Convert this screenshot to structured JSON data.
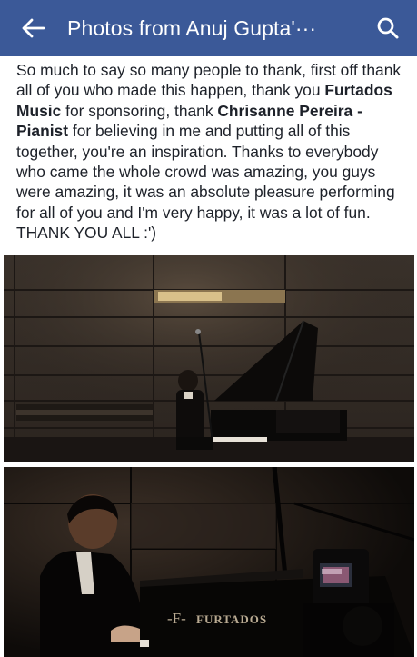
{
  "appbar": {
    "title": "Photos from Anuj Gupta'···",
    "back_icon": "arrow-left-icon",
    "search_icon": "search-icon",
    "color": "#3b5998"
  },
  "caption": {
    "p1": "So much to say so many people to thank, first off thank all of you who made this happen, thank you ",
    "bold1": "Furtados Music",
    "p2": " for sponsoring, thank ",
    "bold2": "Chrisanne Pereira - Pianist",
    "p3": " for believing in me and putting all of this together, you're an inspiration. Thanks to everybody who came the whole crowd was amazing, you guys were amazing, it was an absolute pleasure performing for all of you and I'm very happy, it was a lot of fun. THANK YOU ALL :')"
  },
  "photos": [
    {
      "description_name": "pianist-wide-shot"
    },
    {
      "description_name": "pianist-closeup",
      "piano_brand": "FURTADOS"
    }
  ]
}
